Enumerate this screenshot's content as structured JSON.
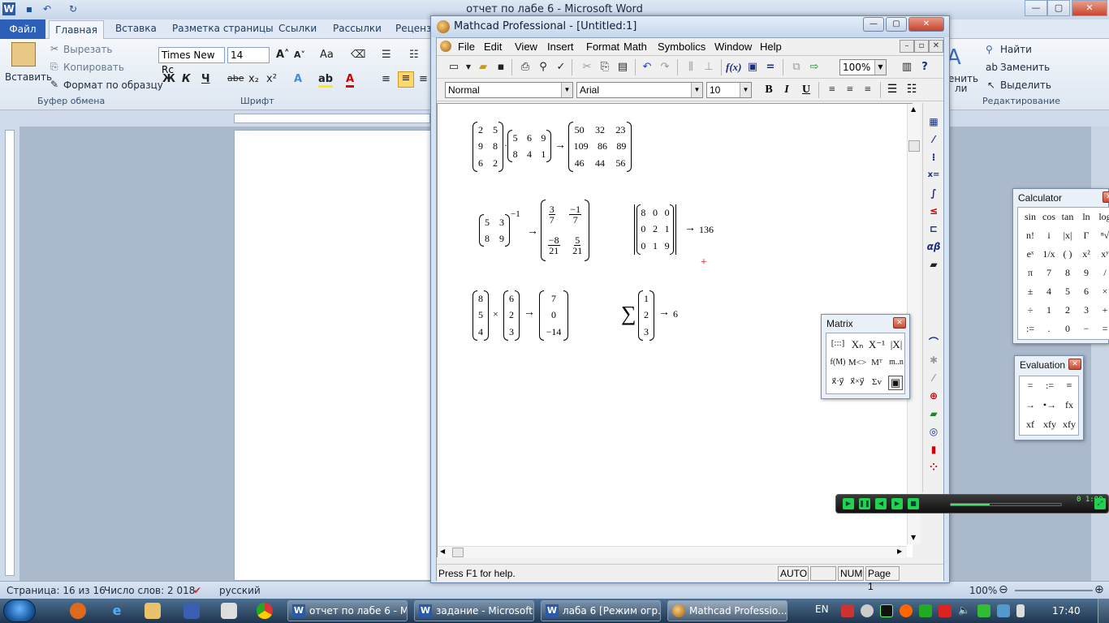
{
  "word": {
    "title": "отчет по лабе 6  -  Microsoft Word",
    "tabs": {
      "file": "Файл",
      "home": "Главная",
      "insert": "Вставка",
      "layout": "Разметка страницы",
      "refs": "Ссылки",
      "mailings": "Рассылки",
      "review": "Реценз"
    },
    "clipboard": {
      "paste": "Вставить",
      "cut": "Вырезать",
      "copy": "Копировать",
      "format_painter": "Формат по образцу",
      "group": "Буфер обмена"
    },
    "font": {
      "name": "Times New Rc",
      "size": "14",
      "group": "Шрифт",
      "bold": "Ж",
      "italic": "К",
      "underline": "Ч",
      "strike": "abe"
    },
    "editing": {
      "find": "Найти",
      "replace": "Заменить",
      "select": "Выделить",
      "group": "Редактирование",
      "partial_right": "енить",
      "partial_right2": "ли"
    },
    "status": {
      "page": "Страница: 16 из 16",
      "words": "Число слов: 2 018",
      "lang": "русский",
      "zoom": "100%"
    }
  },
  "mathcad": {
    "title": "Mathcad Professional - [Untitled:1]",
    "menu": [
      "File",
      "Edit",
      "View",
      "Insert",
      "Format",
      "Math",
      "Symbolics",
      "Window",
      "Help"
    ],
    "zoom": "100%",
    "style": "Normal",
    "font": "Arial",
    "size": "10",
    "status": {
      "help": "Press F1 for help.",
      "mode": "AUTO",
      "num": "NUM",
      "page": "Page 1"
    },
    "expr1": {
      "A": [
        [
          "2",
          "5"
        ],
        [
          "9",
          "8"
        ],
        [
          "6",
          "2"
        ]
      ],
      "B": [
        [
          "5",
          "6",
          "9"
        ],
        [
          "8",
          "4",
          "1"
        ]
      ],
      "R": [
        [
          "50",
          "32",
          "23"
        ],
        [
          "109",
          "86",
          "89"
        ],
        [
          "46",
          "44",
          "56"
        ]
      ]
    },
    "expr2": {
      "A": [
        [
          "5",
          "3"
        ],
        [
          "8",
          "9"
        ]
      ],
      "exp": "−1",
      "R": [
        [
          "3",
          "7",
          "−1",
          "7"
        ],
        [
          "−8",
          "21",
          "5",
          "21"
        ]
      ]
    },
    "expr3": {
      "D": [
        [
          "8",
          "0",
          "0"
        ],
        [
          "0",
          "2",
          "1"
        ],
        [
          "0",
          "1",
          "9"
        ]
      ],
      "result": "136"
    },
    "expr4": {
      "a": [
        "8",
        "5",
        "4"
      ],
      "b": [
        "6",
        "2",
        "3"
      ],
      "op": "×",
      "R": [
        "7",
        "0",
        "−14"
      ]
    },
    "expr5": {
      "v": [
        "1",
        "2",
        "3"
      ],
      "result": "6"
    },
    "arrow": "→",
    "sigma": "∑",
    "dot": "·"
  },
  "palettes": {
    "matrix": {
      "title": "Matrix",
      "items": [
        "[:::]",
        "Xₙ",
        "X⁻¹",
        "|X|",
        "f(M)",
        "M<>",
        "Mᵀ",
        "m..n",
        "x⃗·y⃗",
        "x⃗×y⃗",
        "Σv",
        "▣"
      ]
    },
    "calculator": {
      "title": "Calculator",
      "items": [
        "sin",
        "cos",
        "tan",
        "ln",
        "log",
        "n!",
        "i",
        "|x|",
        "Γ",
        "ⁿ√",
        "eˣ",
        "1/x",
        "( )",
        "x²",
        "xʸ",
        "π",
        "7",
        "8",
        "9",
        "/",
        "±",
        "4",
        "5",
        "6",
        "×",
        "÷",
        "1",
        "2",
        "3",
        "+",
        ":=",
        ".",
        "0",
        "−",
        "="
      ]
    },
    "evaluation": {
      "title": "Evaluation",
      "items": [
        "=",
        ":=",
        "≡",
        "→",
        "•→",
        "fx",
        "xf",
        "xfy",
        "xfy"
      ]
    }
  },
  "player": {
    "time": "0 1:00",
    "progress": 0.35
  },
  "taskbar": {
    "tasks": [
      "отчет по лабе 6 - M...",
      "задание - Microsoft ...",
      "лаба 6 [Режим огр...",
      "Mathcad Professio..."
    ],
    "lang": "EN",
    "clock": "17:40"
  }
}
